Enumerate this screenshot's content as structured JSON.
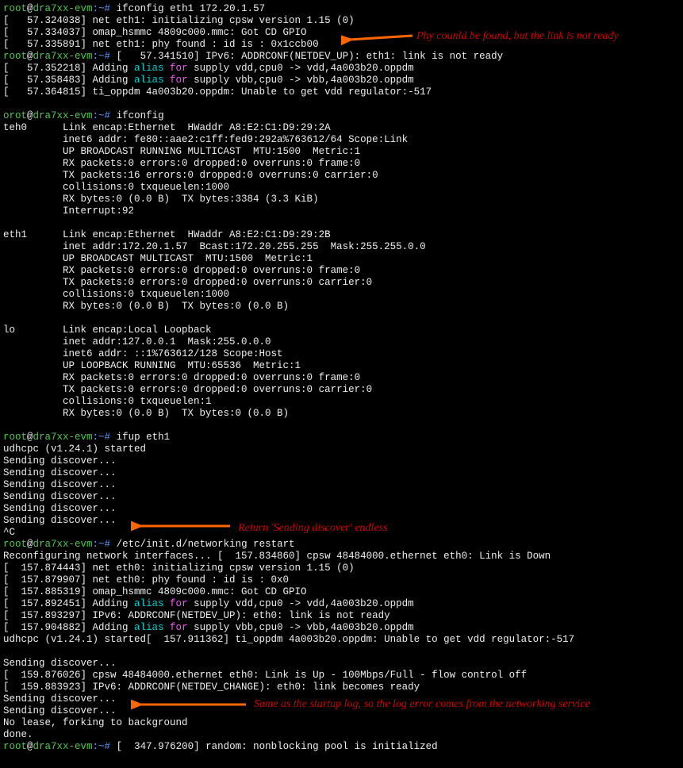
{
  "prompt": {
    "user": "root",
    "at": "@",
    "host": "dra7xx-evm",
    "path": ":~#"
  },
  "annotations": {
    "a1": "Phy counld be found, but the link is not ready",
    "a2": "Return 'Sending discover' endless",
    "a3": "Same as the startup log, so the log error comes from the networking service"
  },
  "cmd": {
    "ifconfig_eth1": " ifconfig eth1 172.20.1.57",
    "ifconfig": " ifconfig",
    "ifup": " ifup eth1",
    "restart": " /etc/init.d/networking restart",
    "trailing": " [  347.976200] random: nonblocking pool is initialized"
  },
  "block1": {
    "l1": "[   57.324038] net eth1: initializing cpsw version 1.15 (0)",
    "l2": "[   57.334037] omap_hsmmc 4809c000.mmc: Got CD GPIO",
    "l3": "[   57.335891] net eth1: phy found : id is : 0x1ccb00",
    "l4a": " [   57.341510] IPv6: ADDRCONF(NETDEV_UP): eth1: link is not ready",
    "l5a": "[   57.352218] Adding ",
    "l5b": "alias",
    "l5c": " for ",
    "l5d": "supply vdd,cpu0 -> vdd,4a003b20.oppdm",
    "l6a": "[   57.358483] Adding ",
    "l6b": "alias",
    "l6c": " for ",
    "l6d": "supply vbb,cpu0 -> vbb,4a003b20.oppdm",
    "l7": "[   57.364815] ti_oppdm 4a003b20.oppdm: Unable to get vdd regulator:-517"
  },
  "ifconfig_out": {
    "oroot": "orot",
    "teh0": "teh0      Link encap:Ethernet  HWaddr A8:E2:C1:D9:29:2A",
    "t1": "          inet6 addr: fe80::aae2:c1ff:fed9:292a%763612/64 Scope:Link",
    "t2": "          UP BROADCAST RUNNING MULTICAST  MTU:1500  Metric:1",
    "t3": "          RX packets:0 errors:0 dropped:0 overruns:0 frame:0",
    "t4": "          TX packets:16 errors:0 dropped:0 overruns:0 carrier:0",
    "t5": "          collisions:0 txqueuelen:1000",
    "t6": "          RX bytes:0 (0.0 B)  TX bytes:3384 (3.3 KiB)",
    "t7": "          Interrupt:92",
    "eth1": "eth1      Link encap:Ethernet  HWaddr A8:E2:C1:D9:29:2B",
    "e1": "          inet addr:172.20.1.57  Bcast:172.20.255.255  Mask:255.255.0.0",
    "e2": "          UP BROADCAST MULTICAST  MTU:1500  Metric:1",
    "e3": "          RX packets:0 errors:0 dropped:0 overruns:0 frame:0",
    "e4": "          TX packets:0 errors:0 dropped:0 overruns:0 carrier:0",
    "e5": "          collisions:0 txqueuelen:1000",
    "e6": "          RX bytes:0 (0.0 B)  TX bytes:0 (0.0 B)",
    "lo": "lo        Link encap:Local Loopback",
    "lo1": "          inet addr:127.0.0.1  Mask:255.0.0.0",
    "lo2": "          inet6 addr: ::1%763612/128 Scope:Host",
    "lo3": "          UP LOOPBACK RUNNING  MTU:65536  Metric:1",
    "lo4": "          RX packets:0 errors:0 dropped:0 overruns:0 frame:0",
    "lo5": "          TX packets:0 errors:0 dropped:0 overruns:0 carrier:0",
    "lo6": "          collisions:0 txqueuelen:1",
    "lo7": "          RX bytes:0 (0.0 B)  TX bytes:0 (0.0 B)"
  },
  "ifup": {
    "l1": "udhcpc (v1.24.1) started",
    "sd": "Sending discover...",
    "ctrlc": "^C"
  },
  "restart": {
    "l1": "Reconfiguring network interfaces... [  157.834860] cpsw 48484000.ethernet eth0: Link is Down",
    "l2": "[  157.874443] net eth0: initializing cpsw version 1.15 (0)",
    "l3": "[  157.879907] net eth0: phy found : id is : 0x0",
    "l4": "[  157.885319] omap_hsmmc 4809c000.mmc: Got CD GPIO",
    "l5a": "[  157.892451] Adding ",
    "l5b": "alias",
    "l5c": " for ",
    "l5d": "supply vdd,cpu0 -> vdd,4a003b20.oppdm",
    "l6": "[  157.893297] IPv6: ADDRCONF(NETDEV_UP): eth0: link is not ready",
    "l7a": "[  157.904882] Adding ",
    "l7b": "alias",
    "l7c": " for ",
    "l7d": "supply vbb,cpu0 -> vbb,4a003b20.oppdm",
    "l8": "udhcpc (v1.24.1) started[  157.911362] ti_oppdm 4a003b20.oppdm: Unable to get vdd regulator:-517",
    "l9": "[  159.876026] cpsw 48484000.ethernet eth0: Link is Up - 100Mbps/Full - flow control off",
    "l10": "[  159.883923] IPv6: ADDRCONF(NETDEV_CHANGE): eth0: link becomes ready",
    "l11": "No lease, forking to background",
    "l12": "done."
  }
}
